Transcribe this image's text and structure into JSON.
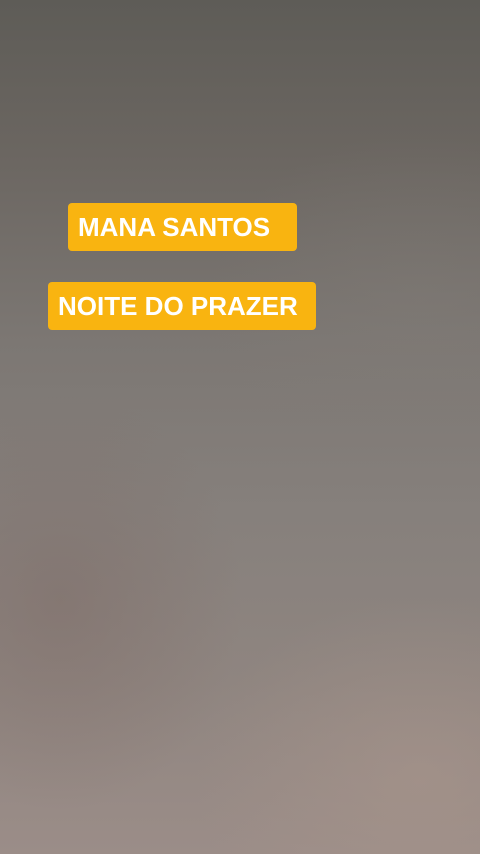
{
  "overlay": {
    "name_label": "MANA SANTOS",
    "title_label": "NOITE DO PRAZER",
    "label_background": "#f9b410",
    "label_text_color": "#ffffff"
  }
}
